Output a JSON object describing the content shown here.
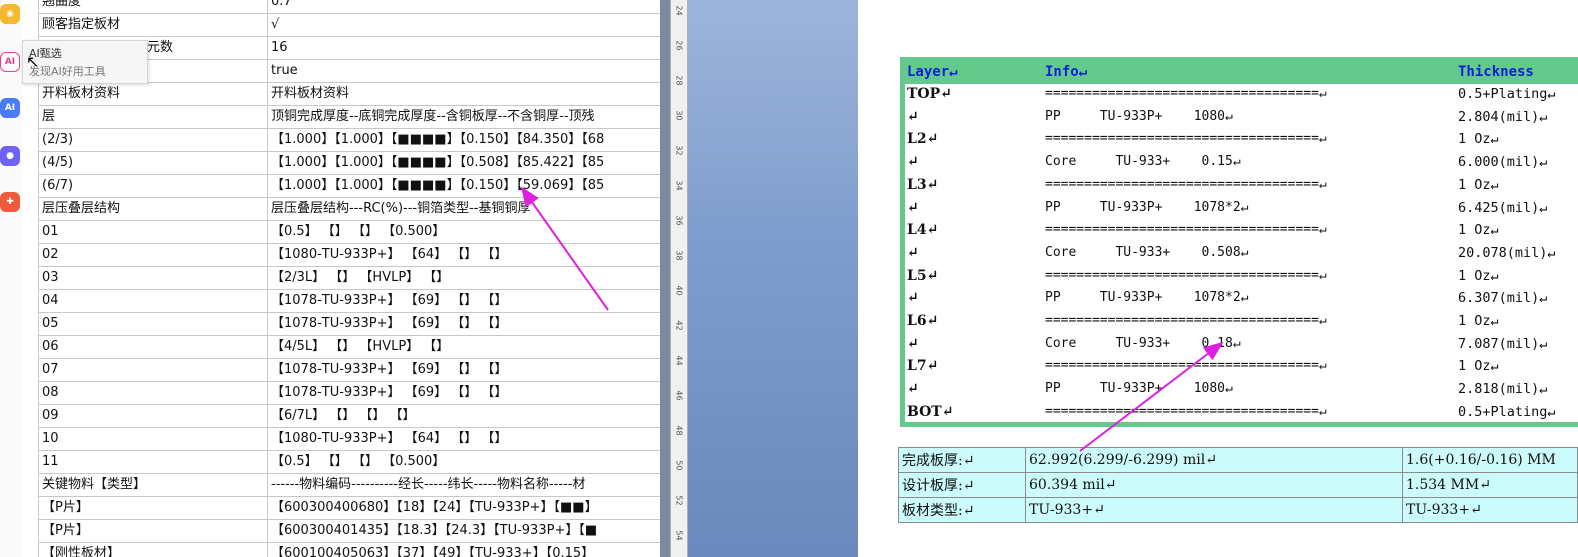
{
  "appbar": {
    "icons": [
      "robot-icon",
      "ai-icon",
      "ai-assistant-icon",
      "chat-bot-icon",
      "game-icon"
    ],
    "ai_label": "AI",
    "ai2_label": "AI"
  },
  "tooltip": {
    "line1": "AI甄选",
    "line2": "发现AI好用工具"
  },
  "sheet": {
    "rows": [
      [
        "翘曲度",
        "0.7"
      ],
      [
        "顾客指定板材",
        "√"
      ],
      [
        "元数",
        "16"
      ],
      [
        "",
        "true"
      ],
      [
        "开料板材资料",
        "开料板材资料"
      ],
      [
        "层",
        "顶铜完成厚度--底铜完成厚度--含铜板厚--不含铜厚--顶残"
      ],
      [
        "(2/3)",
        "【1.000】【1.000】【■■■■】【0.150】【84.350】【68"
      ],
      [
        "(4/5)",
        "【1.000】【1.000】【■■■■】【0.508】【85.422】【85"
      ],
      [
        "(6/7)",
        "【1.000】【1.000】【■■■■】【0.150】【59.069】【85"
      ],
      [
        "层压叠层结构",
        "层压叠层结构---RC(%)---铜箔类型--基铜铜厚"
      ],
      [
        "01",
        "【0.5】 【】 【】 【0.500】"
      ],
      [
        "02",
        "【1080-TU-933P+】 【64】 【】 【】"
      ],
      [
        "03",
        "【2/3L】 【】 【HVLP】 【】"
      ],
      [
        "04",
        "【1078-TU-933P+】 【69】 【】 【】"
      ],
      [
        "05",
        "【1078-TU-933P+】 【69】 【】 【】"
      ],
      [
        "06",
        "【4/5L】 【】 【HVLP】 【】"
      ],
      [
        "07",
        "【1078-TU-933P+】 【69】 【】 【】"
      ],
      [
        "08",
        "【1078-TU-933P+】 【69】 【】 【】"
      ],
      [
        "09",
        "【6/7L】 【】 【】 【】"
      ],
      [
        "10",
        "【1080-TU-933P+】 【64】 【】 【】"
      ],
      [
        "11",
        "【0.5】 【】 【】 【0.500】"
      ],
      [
        "关键物料【类型】",
        "------物料编码----------经长-----纬长-----物料名称-----材"
      ],
      [
        "【P片】",
        "【600300400680】【18】【24】【TU-933P+】【■■】"
      ],
      [
        "【P片】",
        "【600300401435】【18.3】【24.3】【TU-933P+】【■"
      ],
      [
        "【刚性板材】",
        "【600100405063】【37】【49】【TU-933+】【0.15】"
      ]
    ]
  },
  "ruler": {
    "labels": [
      "24",
      "26",
      "28",
      "30",
      "32",
      "34",
      "36",
      "38",
      "40",
      "42",
      "44",
      "46",
      "48",
      "50",
      "52",
      "54"
    ]
  },
  "stackup": {
    "headers": {
      "layer": "Layer↵",
      "info": "Info↵",
      "thickness": "Thickness"
    },
    "rows": [
      [
        "TOP↵",
        "===================================↵",
        "0.5+Plating↵"
      ],
      [
        "↵",
        "PP     TU-933P+    1080↵",
        "2.804(mil)↵"
      ],
      [
        "L2↵",
        "===================================↵",
        "1 Oz↵"
      ],
      [
        "↵",
        "Core     TU-933+    0.15↵",
        "6.000(mil)↵"
      ],
      [
        "L3↵",
        "===================================↵",
        "1 Oz↵"
      ],
      [
        "↵",
        "PP     TU-933P+    1078*2↵",
        "6.425(mil)↵"
      ],
      [
        "L4↵",
        "===================================↵",
        "1 Oz↵"
      ],
      [
        "↵",
        "Core     TU-933+    0.508↵",
        "20.078(mil)↵"
      ],
      [
        "L5↵",
        "===================================↵",
        "1 Oz↵"
      ],
      [
        "↵",
        "PP     TU-933P+    1078*2↵",
        "6.307(mil)↵"
      ],
      [
        "L6↵",
        "===================================↵",
        "1 Oz↵"
      ],
      [
        "↵",
        "Core     TU-933+    0.18↵",
        "7.087(mil)↵"
      ],
      [
        "L7↵",
        "===================================↵",
        "1 Oz↵"
      ],
      [
        "↵",
        "PP     TU-933P+    1080↵",
        "2.818(mil)↵"
      ],
      [
        "BOT↵",
        "===================================↵",
        "0.5+Plating↵"
      ]
    ]
  },
  "summary": {
    "rows": [
      [
        "完成板厚:↵",
        "62.992(6.299/-6.299) mil↵",
        "1.6(+0.16/-0.16) MM"
      ],
      [
        "设计板厚:↵",
        "60.394 mil↵",
        "1.534 MM↵"
      ],
      [
        "板材类型:↵",
        "TU-933+↵",
        "TU-933+↵"
      ]
    ]
  },
  "colors": {
    "table_border": "#64c98c",
    "header_text": "#0a1fd6",
    "summary_bg": "#ccfbfb",
    "arrow": "#e020e0"
  }
}
